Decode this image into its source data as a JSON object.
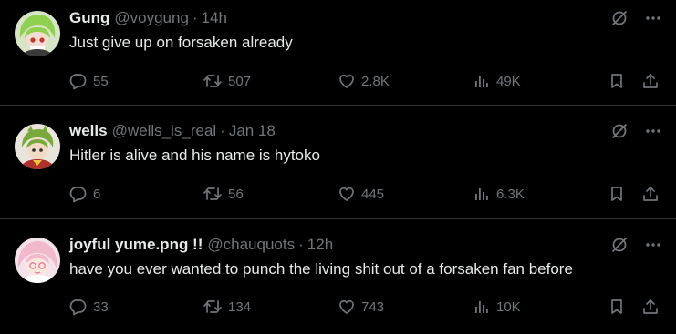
{
  "tweets": [
    {
      "name": "Gung",
      "handle": "@voygung",
      "dot": "·",
      "time": "14h",
      "text": "Just give up on forsaken already",
      "replies": "55",
      "reposts": "507",
      "likes": "2.8K",
      "views": "49K",
      "avatar_colors": {
        "bg": "#d8e4c8",
        "hair": "#8fd14f",
        "face": "#f3ddd2",
        "accent": "#c0392b"
      }
    },
    {
      "name": "wells",
      "handle": "@wells_is_real",
      "dot": "·",
      "time": "Jan 18",
      "text": "Hitler is alive and his name is hytoko",
      "replies": "6",
      "reposts": "56",
      "likes": "445",
      "views": "6.3K",
      "avatar_colors": {
        "bg": "#e9e4dc",
        "hair": "#7aa83a",
        "face": "#f2d9c4",
        "accent": "#b0302a"
      }
    },
    {
      "name": "joyful yume.png !!",
      "handle": "@chauquots",
      "dot": "·",
      "time": "12h",
      "text": "have you ever wanted to punch the living shit out of a forsaken fan before",
      "replies": "33",
      "reposts": "134",
      "likes": "743",
      "views": "10K",
      "avatar_colors": {
        "bg": "#f4e3ea",
        "hair": "#f2b8cc",
        "face": "#fbe7dd",
        "accent": "#e07aa0"
      }
    }
  ],
  "icons": {
    "reply": "reply-icon",
    "repost": "repost-icon",
    "like": "heart-icon",
    "views": "views-icon",
    "bookmark": "bookmark-icon",
    "share": "share-icon",
    "grok": "grok-icon",
    "more": "more-icon"
  },
  "colors": {
    "background": "#000000",
    "primary_text": "#e7e9ea",
    "secondary_text": "#71767b",
    "divider": "#2f3336"
  }
}
